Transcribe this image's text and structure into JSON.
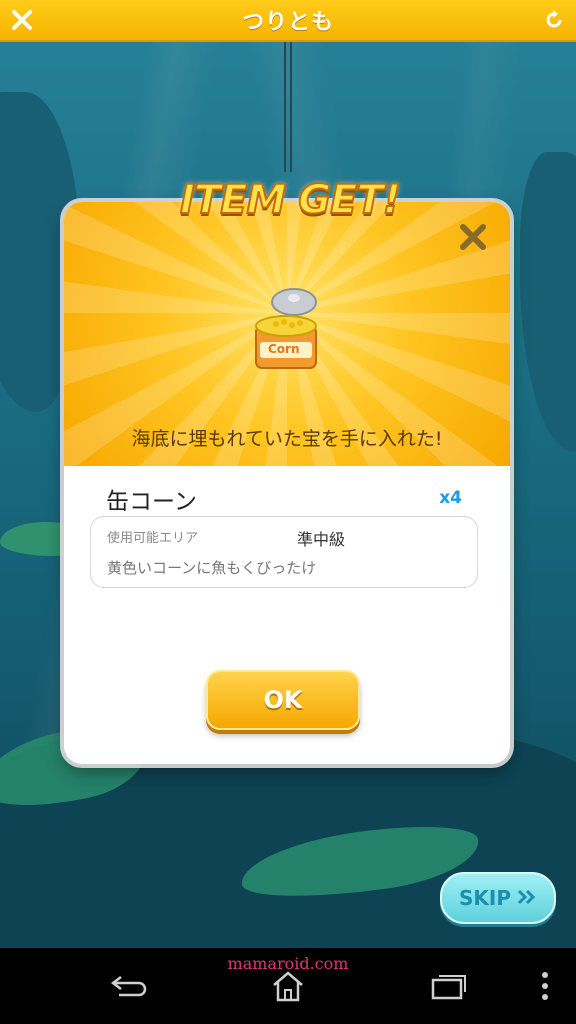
{
  "topbar": {
    "title": "つりとも",
    "close_icon": "close-icon",
    "refresh_icon": "refresh-icon"
  },
  "banner": {
    "text": "ITEM GET!"
  },
  "modal": {
    "message": "海底に埋もれていた宝を手に入れた!",
    "item_name": "缶コーン",
    "item_quantity": "x4",
    "area_label": "使用可能エリア",
    "area_value": "準中級",
    "description": "黄色いコーンに魚もくびったけ",
    "ok_label": "OK",
    "item_icon": "canned-corn-icon",
    "item_icon_text": "Corn"
  },
  "skip": {
    "label": "SKIP"
  },
  "watermark": "mamaroid.com",
  "navbar": {
    "back_icon": "back-icon",
    "home_icon": "home-icon",
    "recents_icon": "recent-apps-icon",
    "menu_icon": "menu-icon"
  },
  "colors": {
    "accent": "#f5b300",
    "qty": "#1e9bdc",
    "skip": "#5fd0dc",
    "water": "#1f7c93"
  }
}
